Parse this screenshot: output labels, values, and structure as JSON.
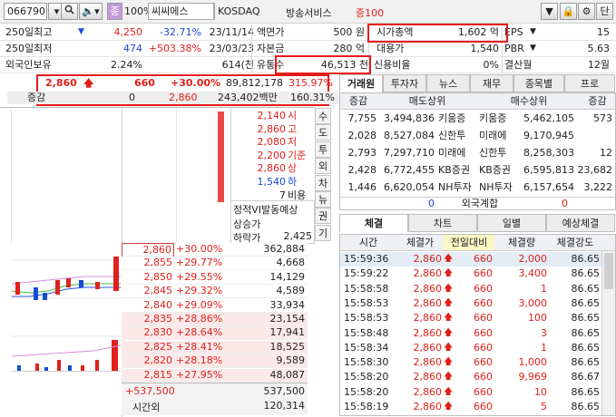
{
  "topbar": {
    "code": "066790",
    "zoom": "100%",
    "mode_label": "종",
    "name": "씨씨에스",
    "market": "KOSDAQ",
    "sector": "방송서비스",
    "margin": "증100",
    "right_btn": "단"
  },
  "info": {
    "r1": {
      "label": "250일최고",
      "change": "▼",
      "val": "4,250",
      "pct": "-32.71%",
      "date": "23/11/14",
      "l2": "액면가",
      "v2": "500 원",
      "l3": "시가총액",
      "v3": "1,602 억",
      "l4": "EPS",
      "v4": "15"
    },
    "r2": {
      "label": "250일최저",
      "val": "474",
      "pct": "+503.38%",
      "date": "23/03/23",
      "l2": "자본금",
      "v2": "280 억",
      "l3": "대용가",
      "v3": "1,540",
      "l4": "PBR",
      "v4": "5.63"
    },
    "r3": {
      "label": "외국인보유",
      "val": "2.24%",
      "qty": "614(천",
      "l2": "유통수",
      "v2": "46,513 천",
      "l3": "신용비율",
      "v3": "0%",
      "l4": "결산월",
      "v4": "12월"
    }
  },
  "price": {
    "current": "2,860",
    "change": "660",
    "pct": "+30.00%",
    "volume": "89,812,178",
    "vol_pct": "315.97%",
    "row2_label": "증감",
    "row2_v1": "0",
    "row2_v2": "2,860",
    "row2_v3": "243,402백만",
    "row2_v4": "160.31%"
  },
  "summary": [
    {
      "value": "2,140",
      "label": "시"
    },
    {
      "value": "2,860",
      "label": "고"
    },
    {
      "value": "2,080",
      "label": "저"
    },
    {
      "value": "2,200",
      "label": "기준"
    },
    {
      "value": "2,860",
      "label": "상"
    },
    {
      "value": "1,540",
      "label": "하"
    },
    {
      "value": "7",
      "label": "비용"
    }
  ],
  "vi": {
    "title": "정적VI발동예상",
    "upper": "상승가",
    "lower": "하락가",
    "lower_val": "2,425"
  },
  "side_buttons": [
    "수",
    "도",
    "투",
    "외",
    "차",
    "뉴",
    "권",
    "기"
  ],
  "ask_rows": [
    {
      "price": "2,860",
      "pct": "+30.00%",
      "qty": "362,884"
    },
    {
      "price": "2,855",
      "pct": "+29.77%",
      "qty": "4,668"
    },
    {
      "price": "2,850",
      "pct": "+29.55%",
      "qty": "14,129"
    },
    {
      "price": "2,845",
      "pct": "+29.32%",
      "qty": "4,589"
    },
    {
      "price": "2,840",
      "pct": "+29.09%",
      "qty": "33,934"
    },
    {
      "price": "2,835",
      "pct": "+28.86%",
      "qty": "23,154"
    },
    {
      "price": "2,830",
      "pct": "+28.64%",
      "qty": "17,941"
    },
    {
      "price": "2,825",
      "pct": "+28.41%",
      "qty": "18,525"
    },
    {
      "price": "2,820",
      "pct": "+28.18%",
      "qty": "9,589"
    },
    {
      "price": "2,815",
      "pct": "+27.95%",
      "qty": "48,087"
    }
  ],
  "bottom": {
    "total_change": "+537,500",
    "total_qty": "537,500",
    "after_label": "시간외",
    "after_qty": "120,314"
  },
  "broker": {
    "tabs": [
      "거래원",
      "투자자",
      "뉴스",
      "재무",
      "종목별",
      "프로"
    ],
    "headers": [
      "증감",
      "매도상위",
      "매수상위",
      "증감"
    ],
    "rows": [
      {
        "d1": "7,755",
        "sell_qty": "3,494,836",
        "sell_name": "키움증",
        "buy_name": "키움증",
        "buy_qty": "5,462,105",
        "d2": "573"
      },
      {
        "d1": "2,028",
        "sell_qty": "8,527,084",
        "sell_name": "신한투",
        "buy_name": "미래에",
        "buy_qty": "9,170,945",
        "d2": ""
      },
      {
        "d1": "2,793",
        "sell_qty": "7,297,710",
        "sell_name": "미래에",
        "buy_name": "신한투",
        "buy_qty": "8,258,303",
        "d2": "12"
      },
      {
        "d1": "2,428",
        "sell_qty": "6,772,455",
        "sell_name": "KB증권",
        "buy_name": "KB증권",
        "buy_qty": "6,595,813",
        "d2": "23,682"
      },
      {
        "d1": "1,446",
        "sell_qty": "6,620,054",
        "sell_name": "NH투자",
        "buy_name": "NH투자",
        "buy_qty": "6,157,654",
        "d2": "3,222"
      }
    ],
    "foreign_left": "0",
    "foreign_label": "외국계합",
    "foreign_right": "0"
  },
  "trades": {
    "tabs": [
      "체결",
      "차트",
      "일별",
      "예상체결"
    ],
    "headers": [
      "시간",
      "체결가",
      "전일대비",
      "체결량",
      "체결강도"
    ],
    "rows": [
      {
        "time": "15:59:36",
        "price": "2,860",
        "diff": "660",
        "qty": "2,000",
        "strength": "86.65"
      },
      {
        "time": "15:59:22",
        "price": "2,860",
        "diff": "660",
        "qty": "3,400",
        "strength": "86.65"
      },
      {
        "time": "15:58:58",
        "price": "2,860",
        "diff": "660",
        "qty": "1",
        "strength": "86.65"
      },
      {
        "time": "15:58:53",
        "price": "2,860",
        "diff": "660",
        "qty": "3,000",
        "strength": "86.65"
      },
      {
        "time": "15:58:53",
        "price": "2,860",
        "diff": "660",
        "qty": "100",
        "strength": "86.65"
      },
      {
        "time": "15:58:48",
        "price": "2,860",
        "diff": "660",
        "qty": "3",
        "strength": "86.65"
      },
      {
        "time": "15:58:34",
        "price": "2,860",
        "diff": "660",
        "qty": "1",
        "strength": "86.65"
      },
      {
        "time": "15:58:30",
        "price": "2,860",
        "diff": "660",
        "qty": "1,000",
        "strength": "86.65"
      },
      {
        "time": "15:58:20",
        "price": "2,860",
        "diff": "660",
        "qty": "9,969",
        "strength": "86.67"
      },
      {
        "time": "15:58:20",
        "price": "2,860",
        "diff": "660",
        "qty": "10",
        "strength": "86.65"
      },
      {
        "time": "15:58:19",
        "price": "2,860",
        "diff": "660",
        "qty": "5",
        "strength": "86.65"
      }
    ]
  },
  "colors": {
    "up": "#e0211b",
    "down": "#1a49d8",
    "highlight": "#e51c1c"
  }
}
